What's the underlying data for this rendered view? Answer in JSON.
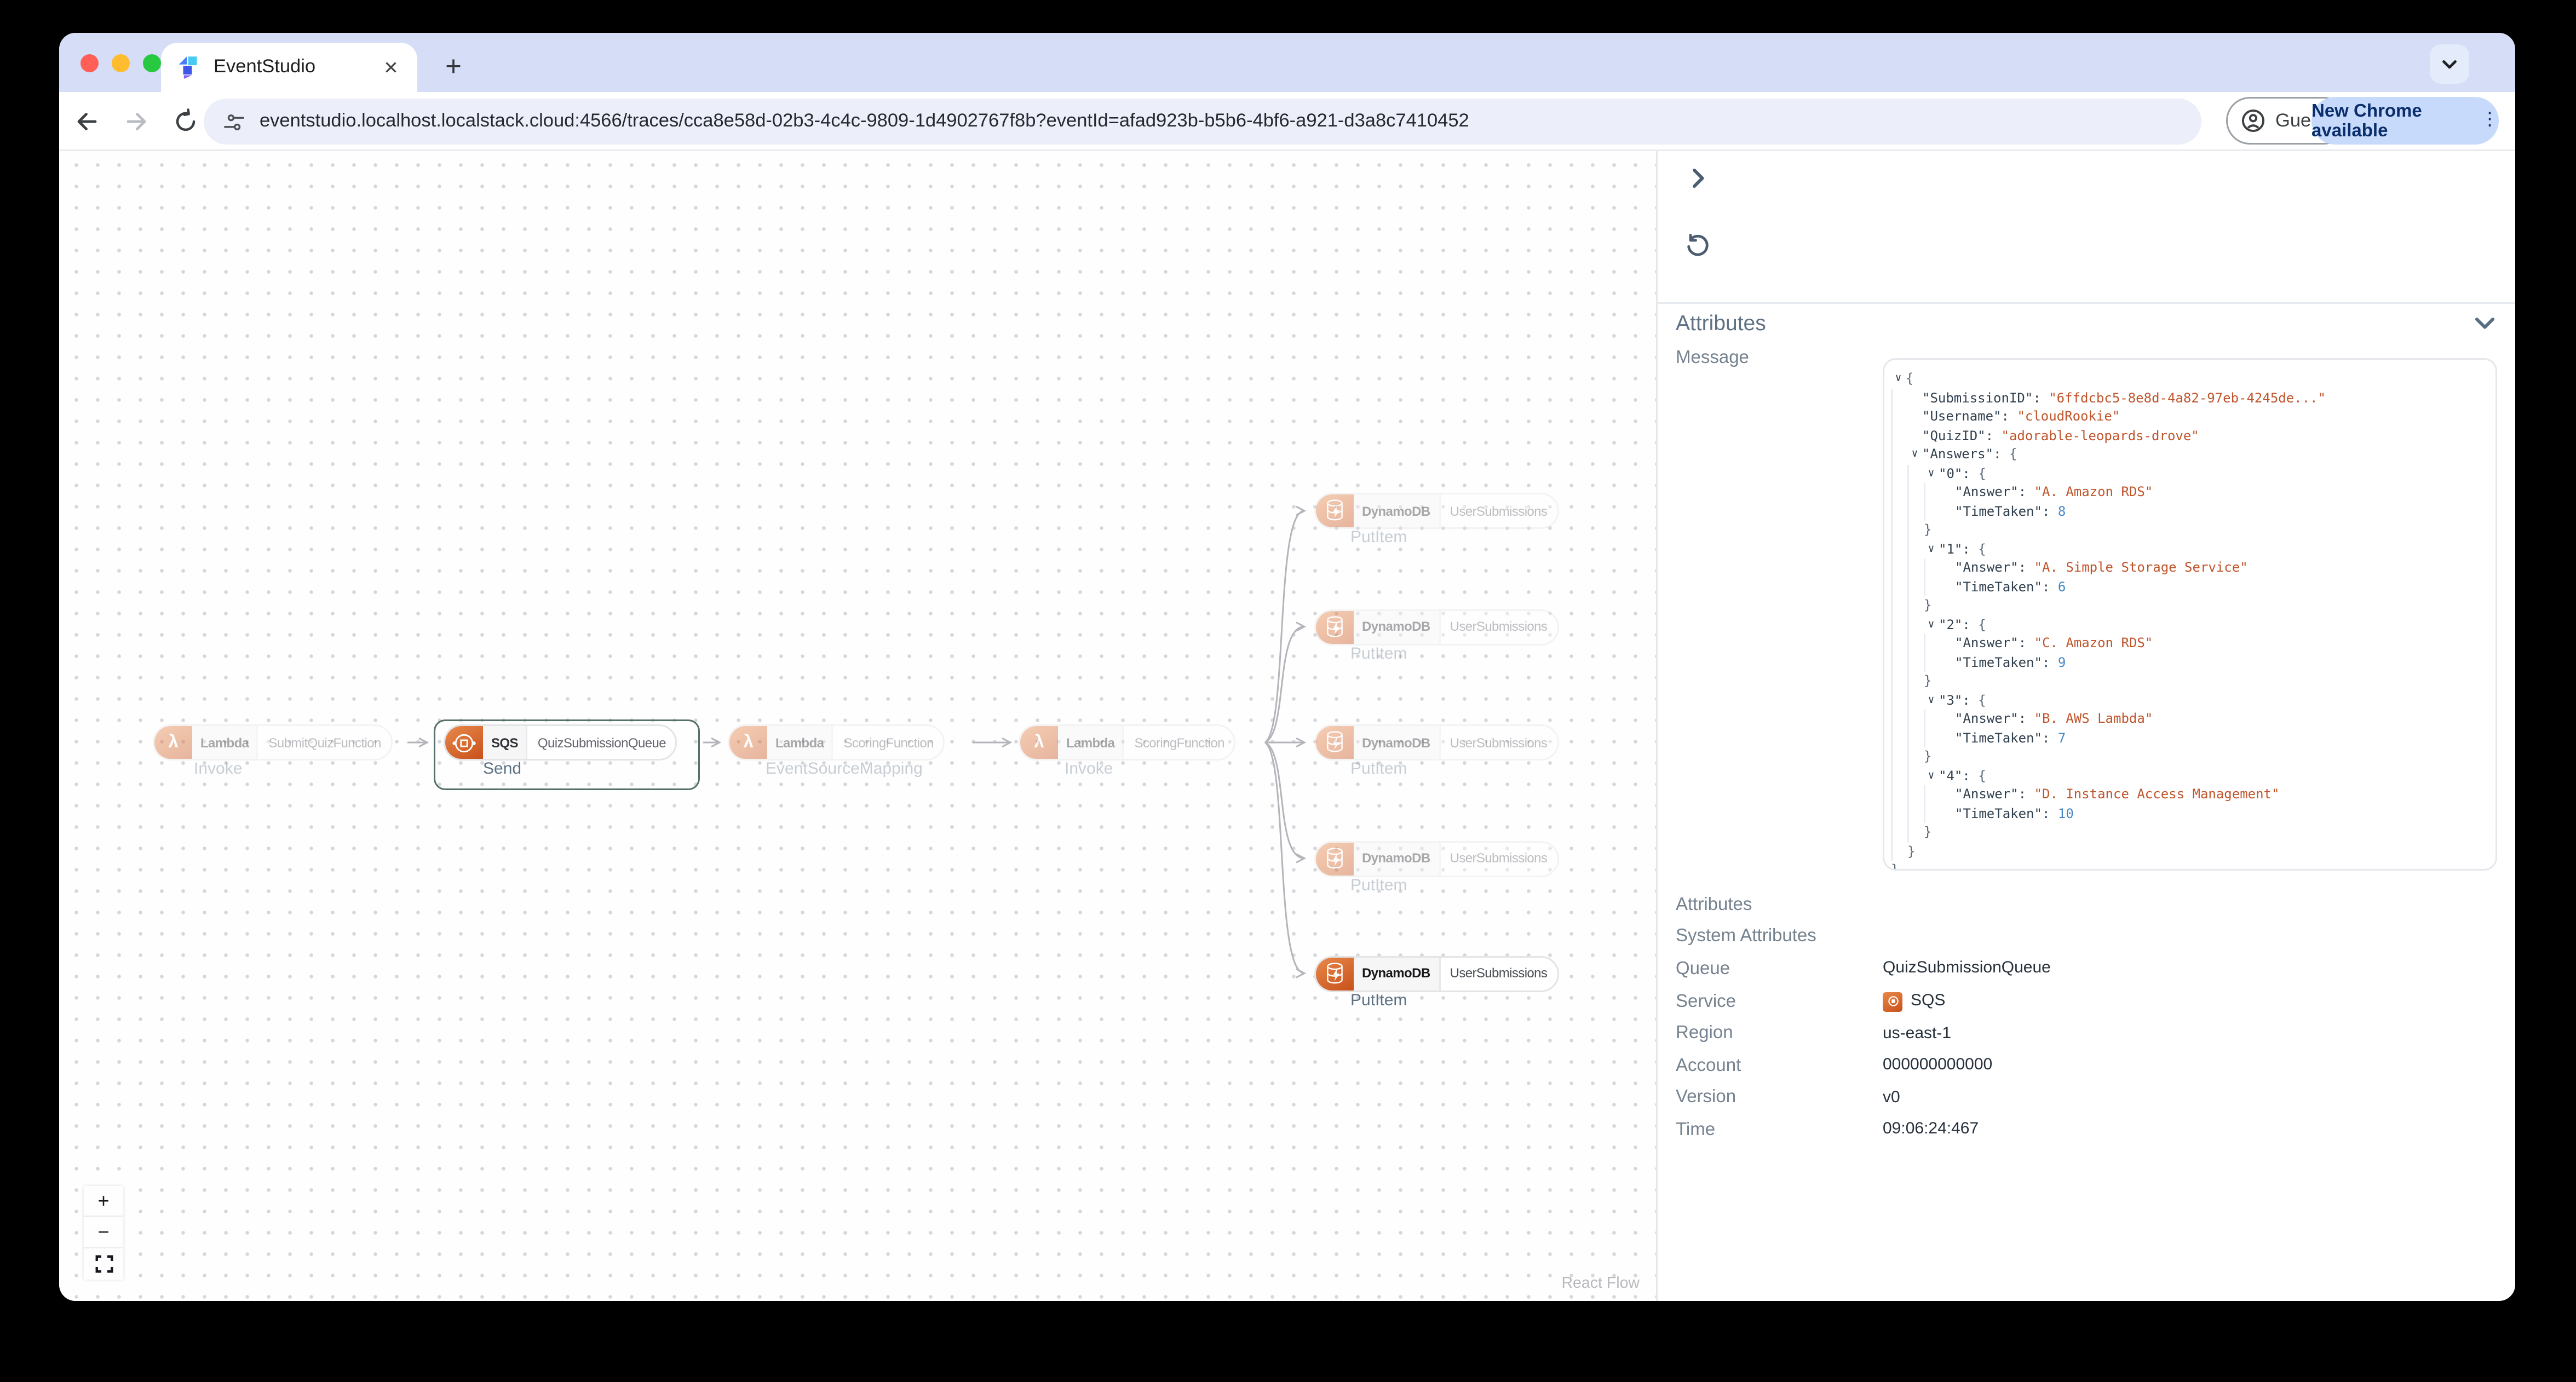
{
  "browser": {
    "tab_title": "EventStudio",
    "close_tab_glyph": "✕",
    "new_tab_glyph": "+",
    "url": "eventstudio.localhost.localstack.cloud:4566/traces/cca8e58d-02b3-4c4c-9809-1d4902767f8b?eventId=afad923b-b5b6-4bf6-a921-d3a8c7410452",
    "guest_label": "Guest",
    "update_label": "New Chrome available",
    "menu_dots_glyph": "⋮"
  },
  "flow": {
    "nodes": [
      {
        "service": "Lambda",
        "resource": "SubmitQuizFunction",
        "operation": "Invoke"
      },
      {
        "service": "SQS",
        "resource": "QuizSubmissionQueue",
        "operation": "Send"
      },
      {
        "service": "Lambda",
        "resource": "ScoringFunction",
        "operation": "EventSourceMapping"
      },
      {
        "service": "Lambda",
        "resource": "ScoringFunction",
        "operation": "Invoke"
      },
      {
        "service": "DynamoDB",
        "resource": "UserSubmissions",
        "operation": "PutItem"
      },
      {
        "service": "DynamoDB",
        "resource": "UserSubmissions",
        "operation": "PutItem"
      },
      {
        "service": "DynamoDB",
        "resource": "UserSubmissions",
        "operation": "PutItem"
      },
      {
        "service": "DynamoDB",
        "resource": "UserSubmissions",
        "operation": "PutItem"
      },
      {
        "service": "DynamoDB",
        "resource": "UserSubmissions",
        "operation": "PutItem"
      }
    ],
    "controls": {
      "zoom_in": "+",
      "zoom_out": "−"
    },
    "attribution": "React Flow"
  },
  "panel": {
    "attributes_header": "Attributes",
    "message_label": "Message",
    "details": {
      "attributes_label": "Attributes",
      "system_attributes_label": "System Attributes",
      "queue_label": "Queue",
      "queue_value": "QuizSubmissionQueue",
      "service_label": "Service",
      "service_value": "SQS",
      "region_label": "Region",
      "region_value": "us-east-1",
      "account_label": "Account",
      "account_value": "000000000000",
      "version_label": "Version",
      "version_value": "v0",
      "time_label": "Time",
      "time_value": "09:06:24:467"
    }
  },
  "message_json": {
    "SubmissionID": "6ffdcbc5-8e8d-4a82-97eb-4245de...",
    "Username": "cloudRookie",
    "QuizID": "adorable-leopards-drove",
    "Answers": {
      "0": {
        "Answer": "A. Amazon RDS",
        "TimeTaken": 8
      },
      "1": {
        "Answer": "A. Simple Storage Service",
        "TimeTaken": 6
      },
      "2": {
        "Answer": "C. Amazon RDS",
        "TimeTaken": 9
      },
      "3": {
        "Answer": "B. AWS Lambda",
        "TimeTaken": 7
      },
      "4": {
        "Answer": "D. Instance Access Management",
        "TimeTaken": 10
      }
    }
  },
  "colors": {
    "accent_orange": "#c8511b",
    "json_key": "#32414f",
    "json_string": "#c0552c",
    "json_number": "#4687c8",
    "selection_border": "#567169",
    "edge": "#b4b4bb"
  }
}
